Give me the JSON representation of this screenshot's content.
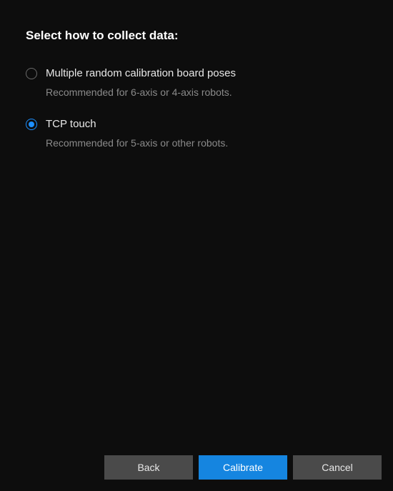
{
  "title": "Select how to collect data:",
  "options": [
    {
      "label": "Multiple random calibration board poses",
      "description": "Recommended for 6-axis or 4-axis robots.",
      "selected": false
    },
    {
      "label": "TCP touch",
      "description": "Recommended for 5-axis or other robots.",
      "selected": true
    }
  ],
  "buttons": {
    "back": "Back",
    "calibrate": "Calibrate",
    "cancel": "Cancel"
  }
}
